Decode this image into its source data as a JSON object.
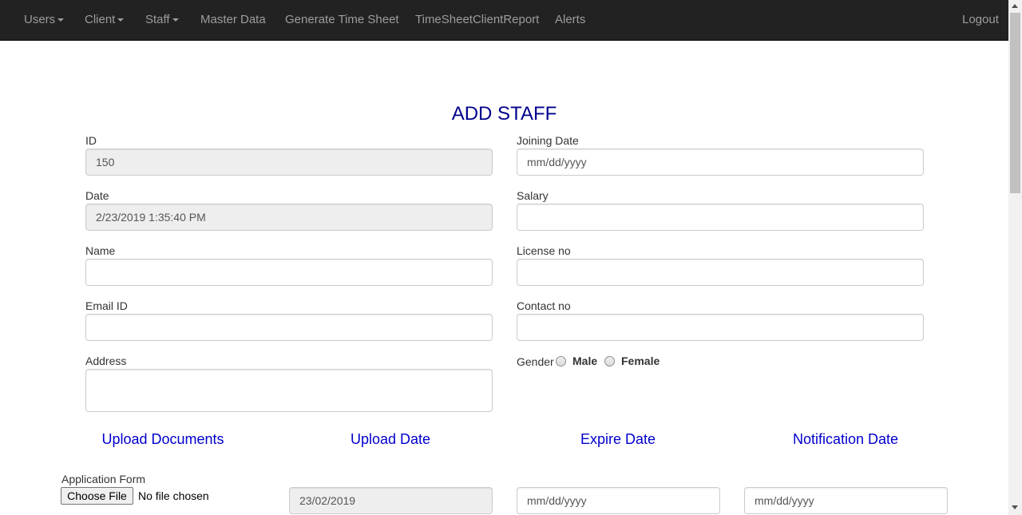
{
  "nav": {
    "users": "Users",
    "client": "Client",
    "staff": "Staff",
    "master_data": "Master Data",
    "generate_time_sheet": "Generate Time Sheet",
    "timesheet_client_report": "TimeSheetClientReport",
    "alerts": "Alerts",
    "logout": "Logout"
  },
  "page_title": "ADD STAFF",
  "form": {
    "id": {
      "label": "ID",
      "value": "150"
    },
    "date": {
      "label": "Date",
      "value": "2/23/2019 1:35:40 PM"
    },
    "name": {
      "label": "Name",
      "value": ""
    },
    "email": {
      "label": "Email ID",
      "value": ""
    },
    "address": {
      "label": "Address",
      "value": ""
    },
    "joining_date": {
      "label": "Joining Date",
      "placeholder": "mm/dd/yyyy"
    },
    "salary": {
      "label": "Salary",
      "value": ""
    },
    "license_no": {
      "label": "License no",
      "value": ""
    },
    "contact_no": {
      "label": "Contact no",
      "value": ""
    },
    "gender": {
      "label": "Gender",
      "options": [
        "Male",
        "Female"
      ]
    }
  },
  "documents": {
    "headers": [
      "Upload Documents",
      "Upload Date",
      "Expire Date",
      "Notification Date"
    ],
    "rows": [
      {
        "name": "Application Form",
        "file_button": "Choose File",
        "file_status": "No file chosen",
        "upload_date": "23/02/2019",
        "expire_placeholder": "mm/dd/yyyy",
        "notification_placeholder": "mm/dd/yyyy"
      }
    ]
  },
  "colors": {
    "navbar": "#222222",
    "nav_text": "#9d9d9d",
    "title": "#00008b",
    "doc_header": "#0000cd"
  }
}
